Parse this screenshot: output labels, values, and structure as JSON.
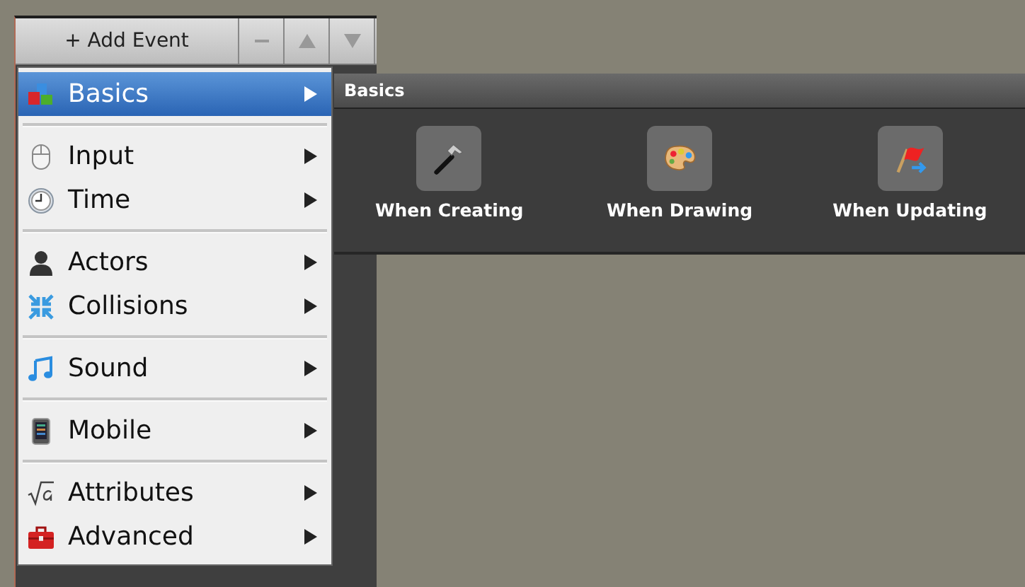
{
  "toolbar": {
    "add_button": "+ Add Event"
  },
  "menu": {
    "groups": [
      [
        {
          "label": "Basics",
          "selected": true
        }
      ],
      [
        {
          "label": "Input",
          "selected": false
        },
        {
          "label": "Time",
          "selected": false
        }
      ],
      [
        {
          "label": "Actors",
          "selected": false
        },
        {
          "label": "Collisions",
          "selected": false
        }
      ],
      [
        {
          "label": "Sound",
          "selected": false
        }
      ],
      [
        {
          "label": "Mobile",
          "selected": false
        }
      ],
      [
        {
          "label": "Attributes",
          "selected": false
        },
        {
          "label": "Advanced",
          "selected": false
        }
      ]
    ]
  },
  "submenu": {
    "title": "Basics",
    "events": [
      {
        "label": "When Creating"
      },
      {
        "label": "When Drawing"
      },
      {
        "label": "When Updating"
      }
    ]
  }
}
